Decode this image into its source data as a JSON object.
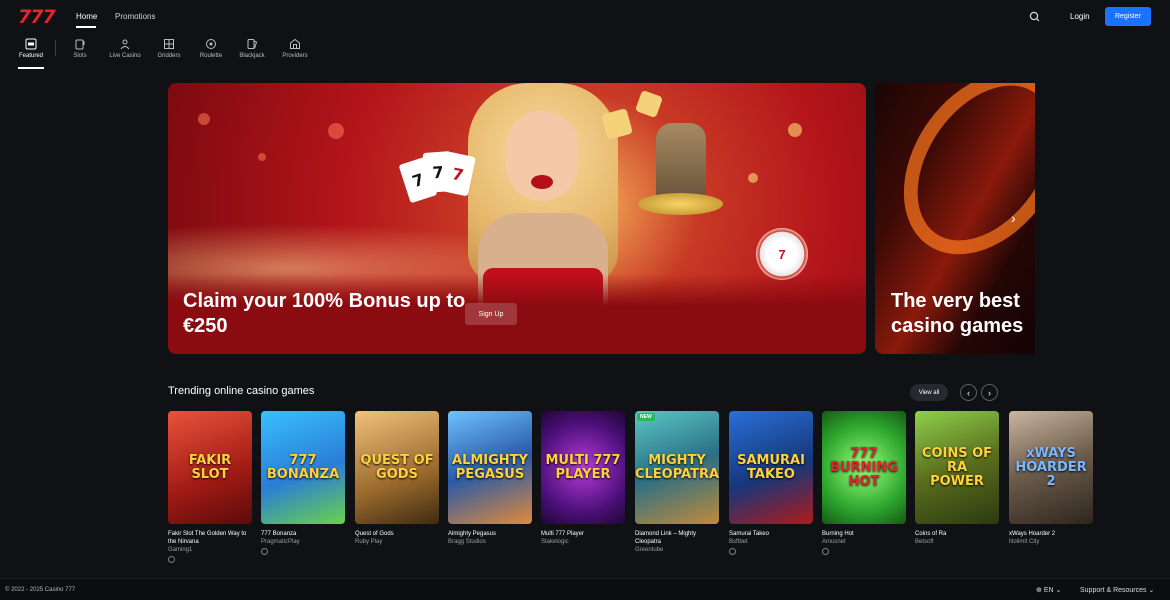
{
  "header": {
    "logo": "777",
    "nav": [
      "Home",
      "Promotions"
    ],
    "login": "Login",
    "register": "Register"
  },
  "categories": [
    "Featured",
    "Slots",
    "Live Casino",
    "Gridders",
    "Roulette",
    "Blackjack",
    "Providers"
  ],
  "hero": {
    "title": "Claim your 100% Bonus up to €250",
    "button": "Sign Up",
    "card_ranks": [
      "7",
      "7",
      "7"
    ],
    "chip_text": "7"
  },
  "hero2": {
    "title_line1": "The very best",
    "title_line2": "casino games"
  },
  "trending": {
    "title": "Trending online casino games",
    "view_all": "View all",
    "games": [
      {
        "name": "Fakir Slot The Golden Way to the Nirvana",
        "provider": "Gaming1",
        "art": "FAKIR SLOT",
        "new": false
      },
      {
        "name": "777 Bonanza",
        "provider": "PragmaticPlay",
        "art": "777 BONANZA",
        "new": false
      },
      {
        "name": "Quest of Gods",
        "provider": "Ruby Play",
        "art": "QUEST OF GODS",
        "new": false
      },
      {
        "name": "Almighty Pegasus",
        "provider": "Bragg Studios",
        "art": "ALMIGHTY PEGASUS",
        "new": false
      },
      {
        "name": "Multi 777 Player",
        "provider": "Stakelogic",
        "art": "MULTI 777 PLAYER",
        "new": false
      },
      {
        "name": "Diamond Link – Mighty Cleopatra",
        "provider": "Greentube",
        "art": "MIGHTY CLEOPATRA",
        "new": true,
        "badge": "NEW"
      },
      {
        "name": "Samurai Takeo",
        "provider": "Bsftbet",
        "art": "SAMURAI TAKEO",
        "new": false
      },
      {
        "name": "Burning Hot",
        "provider": "Amusnet",
        "art": "777 BURNING HOT",
        "new": false
      },
      {
        "name": "Coins of Ra",
        "provider": "Betsoft",
        "art": "COINS OF RA POWER",
        "new": false
      },
      {
        "name": "xWays Hoarder 2",
        "provider": "Nolimit City",
        "art": "xWAYS HOARDER 2",
        "new": false
      }
    ]
  },
  "footer": {
    "copyright": "© 2022 - 2025 Casino 777",
    "language": "EN",
    "support": "Support & Resources"
  }
}
